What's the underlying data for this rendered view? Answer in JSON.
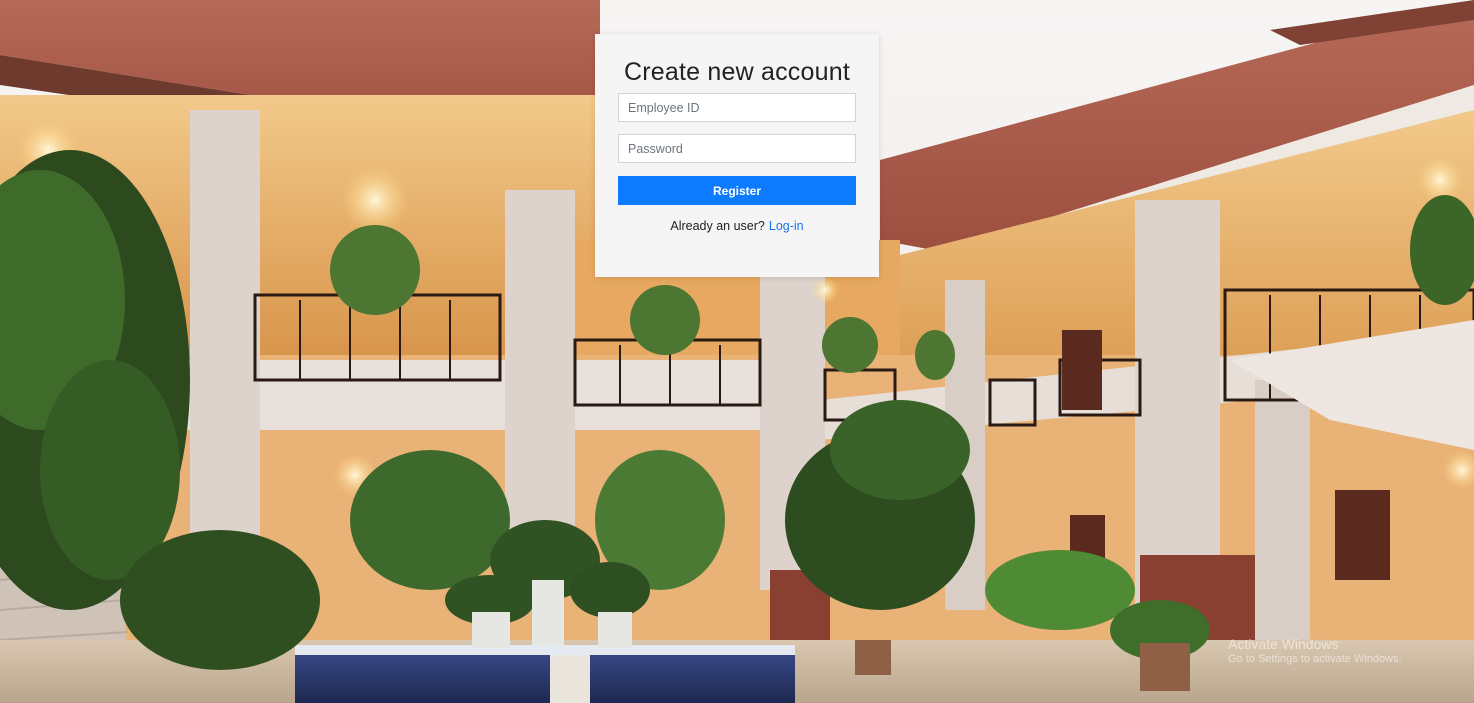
{
  "background": {
    "description_icon": "building-courtyard-photo"
  },
  "form": {
    "title": "Create new account",
    "employee_id_placeholder": "Employee ID",
    "password_placeholder": "Password",
    "register_label": "Register",
    "already_user_text": "Already an user?",
    "login_link": "Log-in"
  },
  "watermark": {
    "line1": "Activate Windows",
    "line2": "Go to Settings to activate Windows."
  },
  "colors": {
    "primary": "#0d7bff",
    "link": "#1a73e8",
    "card_bg": "#f5f5f5"
  }
}
